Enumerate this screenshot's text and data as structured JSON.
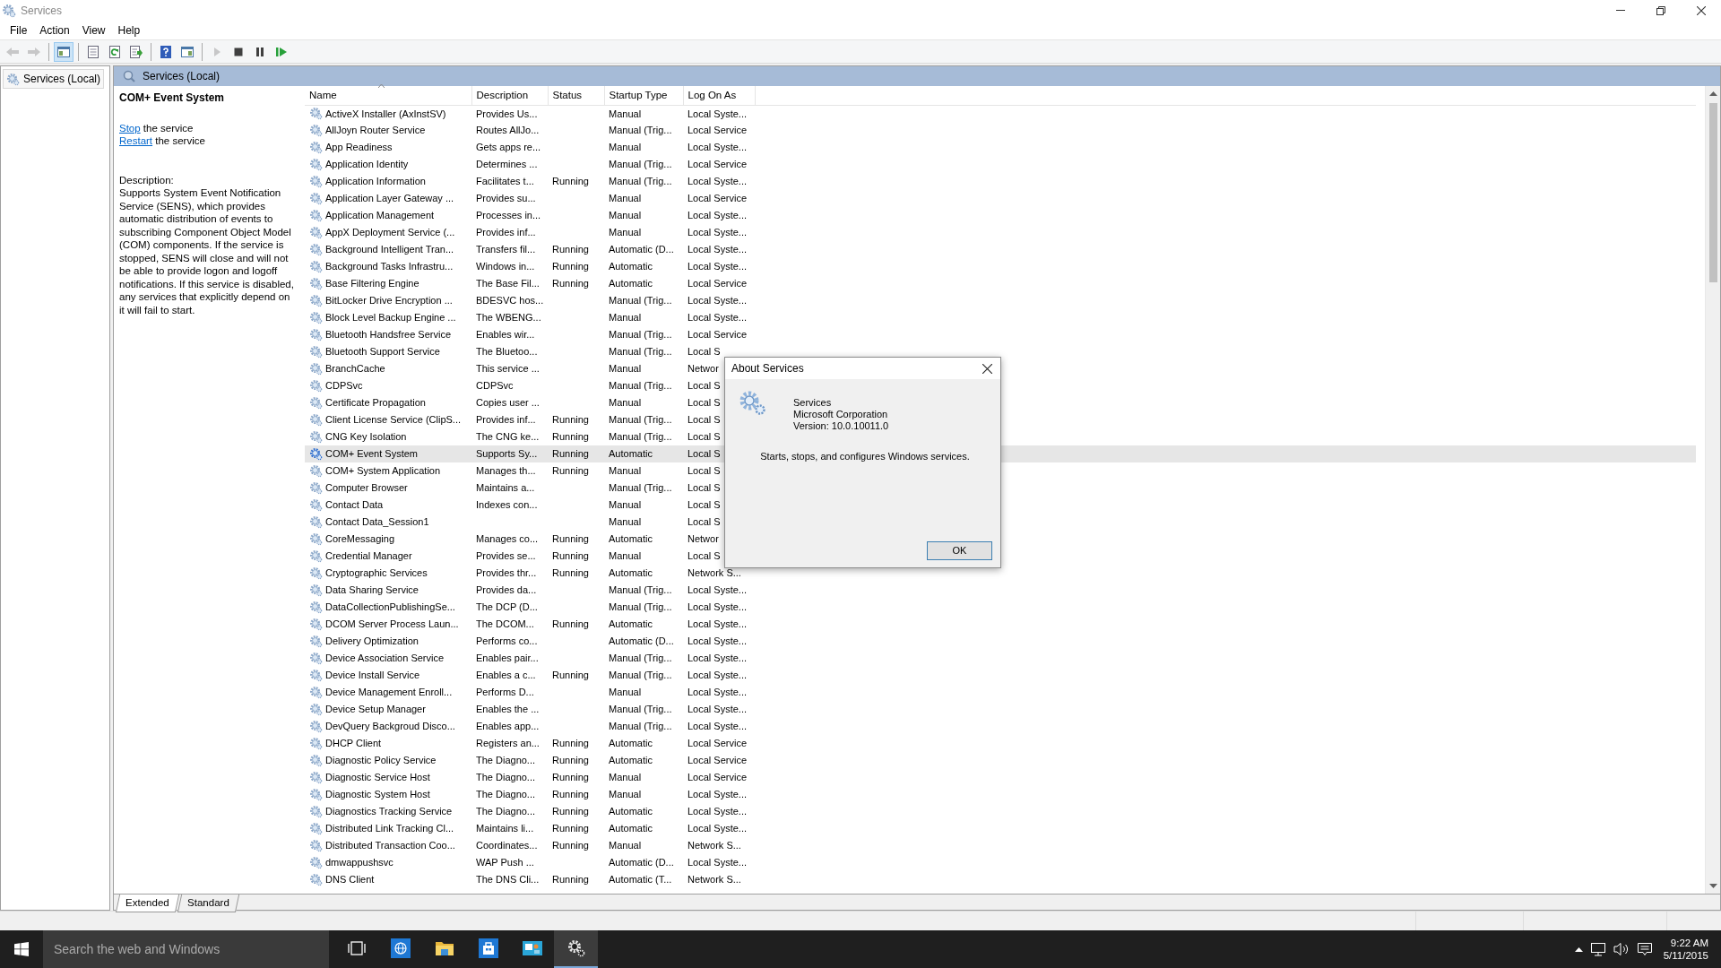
{
  "window": {
    "title": "Services"
  },
  "menu": [
    {
      "label": "File"
    },
    {
      "label": "Action"
    },
    {
      "label": "View"
    },
    {
      "label": "Help"
    }
  ],
  "toolbar": [
    {
      "kind": "back",
      "disabled": true,
      "pressed": false
    },
    {
      "kind": "forward",
      "disabled": true,
      "pressed": false
    },
    {
      "kind": "separator"
    },
    {
      "kind": "tree",
      "disabled": false,
      "pressed": true
    },
    {
      "kind": "separator"
    },
    {
      "kind": "properties",
      "disabled": false,
      "pressed": false
    },
    {
      "kind": "refresh",
      "disabled": false,
      "pressed": false
    },
    {
      "kind": "export",
      "disabled": false,
      "pressed": false
    },
    {
      "kind": "separator"
    },
    {
      "kind": "help",
      "disabled": false,
      "pressed": false
    },
    {
      "kind": "actionpane",
      "disabled": false,
      "pressed": false
    },
    {
      "kind": "separator"
    },
    {
      "kind": "start",
      "disabled": true,
      "pressed": false
    },
    {
      "kind": "stop",
      "disabled": false,
      "pressed": false
    },
    {
      "kind": "pause",
      "disabled": false,
      "pressed": false
    },
    {
      "kind": "resume",
      "disabled": false,
      "pressed": false
    }
  ],
  "tree": [
    {
      "label": "Services (Local)",
      "selected": true
    }
  ],
  "pane_header": "Services (Local)",
  "details": {
    "title": "COM+ Event System",
    "actions": [
      {
        "link": "Stop",
        "text": "the service"
      },
      {
        "link": "Restart",
        "text": "the service"
      }
    ],
    "description_label": "Description:",
    "description": "Supports System Event Notification Service (SENS), which provides automatic distribution of events to subscribing Component Object Model (COM) components. If the service is stopped, SENS will close and will not be able to provide logon and logoff notifications. If this service is disabled, any services that explicitly depend on it will fail to start."
  },
  "table": {
    "columns": [
      {
        "label": "Name",
        "sorted": true
      },
      {
        "label": "Description",
        "sorted": false
      },
      {
        "label": "Status",
        "sorted": false
      },
      {
        "label": "Startup Type",
        "sorted": false
      },
      {
        "label": "Log On As",
        "sorted": false
      }
    ],
    "rows": [
      {
        "name": "ActiveX Installer (AxInstSV)",
        "description": "Provides Us...",
        "startup": "Manual",
        "logon": "Local Syste...",
        "selected": false
      },
      {
        "name": "AllJoyn Router Service",
        "description": "Routes AllJo...",
        "startup": "Manual (Trig...",
        "logon": "Local Service",
        "selected": false
      },
      {
        "name": "App Readiness",
        "description": "Gets apps re...",
        "startup": "Manual",
        "logon": "Local Syste...",
        "selected": false
      },
      {
        "name": "Application Identity",
        "description": "Determines ...",
        "startup": "Manual (Trig...",
        "logon": "Local Service",
        "selected": false
      },
      {
        "name": "Application Information",
        "description": "Facilitates t...",
        "status": "Running",
        "startup": "Manual (Trig...",
        "logon": "Local Syste...",
        "selected": false
      },
      {
        "name": "Application Layer Gateway ...",
        "description": "Provides su...",
        "startup": "Manual",
        "logon": "Local Service",
        "selected": false
      },
      {
        "name": "Application Management",
        "description": "Processes in...",
        "startup": "Manual",
        "logon": "Local Syste...",
        "selected": false
      },
      {
        "name": "AppX Deployment Service (...",
        "description": "Provides inf...",
        "startup": "Manual",
        "logon": "Local Syste...",
        "selected": false
      },
      {
        "name": "Background Intelligent Tran...",
        "description": "Transfers fil...",
        "status": "Running",
        "startup": "Automatic (D...",
        "logon": "Local Syste...",
        "selected": false
      },
      {
        "name": "Background Tasks Infrastru...",
        "description": "Windows in...",
        "status": "Running",
        "startup": "Automatic",
        "logon": "Local Syste...",
        "selected": false
      },
      {
        "name": "Base Filtering Engine",
        "description": "The Base Fil...",
        "status": "Running",
        "startup": "Automatic",
        "logon": "Local Service",
        "selected": false
      },
      {
        "name": "BitLocker Drive Encryption ...",
        "description": "BDESVC hos...",
        "startup": "Manual (Trig...",
        "logon": "Local Syste...",
        "selected": false
      },
      {
        "name": "Block Level Backup Engine ...",
        "description": "The WBENG...",
        "startup": "Manual",
        "logon": "Local Syste...",
        "selected": false
      },
      {
        "name": "Bluetooth Handsfree Service",
        "description": "Enables wir...",
        "startup": "Manual (Trig...",
        "logon": "Local Service",
        "selected": false
      },
      {
        "name": "Bluetooth Support Service",
        "description": "The Bluetoo...",
        "startup": "Manual (Trig...",
        "logon": "Local S",
        "selected": false
      },
      {
        "name": "BranchCache",
        "description": "This service ...",
        "startup": "Manual",
        "logon": "Networ",
        "selected": false
      },
      {
        "name": "CDPSvc",
        "description": "CDPSvc",
        "startup": "Manual (Trig...",
        "logon": "Local S",
        "selected": false
      },
      {
        "name": "Certificate Propagation",
        "description": "Copies user ...",
        "startup": "Manual",
        "logon": "Local S",
        "selected": false
      },
      {
        "name": "Client License Service (ClipS...",
        "description": "Provides inf...",
        "status": "Running",
        "startup": "Manual (Trig...",
        "logon": "Local S",
        "selected": false
      },
      {
        "name": "CNG Key Isolation",
        "description": "The CNG ke...",
        "status": "Running",
        "startup": "Manual (Trig...",
        "logon": "Local S",
        "selected": false
      },
      {
        "name": "COM+ Event System",
        "description": "Supports Sy...",
        "status": "Running",
        "startup": "Automatic",
        "logon": "Local S",
        "selected": true
      },
      {
        "name": "COM+ System Application",
        "description": "Manages th...",
        "status": "Running",
        "startup": "Manual",
        "logon": "Local S",
        "selected": false
      },
      {
        "name": "Computer Browser",
        "description": "Maintains a...",
        "startup": "Manual (Trig...",
        "logon": "Local S",
        "selected": false
      },
      {
        "name": "Contact Data",
        "description": "Indexes con...",
        "startup": "Manual",
        "logon": "Local S",
        "selected": false
      },
      {
        "name": "Contact Data_Session1",
        "startup": "Manual",
        "logon": "Local S",
        "selected": false
      },
      {
        "name": "CoreMessaging",
        "description": "Manages co...",
        "status": "Running",
        "startup": "Automatic",
        "logon": "Networ",
        "selected": false
      },
      {
        "name": "Credential Manager",
        "description": "Provides se...",
        "status": "Running",
        "startup": "Manual",
        "logon": "Local S",
        "selected": false
      },
      {
        "name": "Cryptographic Services",
        "description": "Provides thr...",
        "status": "Running",
        "startup": "Automatic",
        "logon": "Network S...",
        "selected": false
      },
      {
        "name": "Data Sharing Service",
        "description": "Provides da...",
        "startup": "Manual (Trig...",
        "logon": "Local Syste...",
        "selected": false
      },
      {
        "name": "DataCollectionPublishingSe...",
        "description": "The DCP (D...",
        "startup": "Manual (Trig...",
        "logon": "Local Syste...",
        "selected": false
      },
      {
        "name": "DCOM Server Process Laun...",
        "description": "The DCOM...",
        "status": "Running",
        "startup": "Automatic",
        "logon": "Local Syste...",
        "selected": false
      },
      {
        "name": "Delivery Optimization",
        "description": "Performs co...",
        "startup": "Automatic (D...",
        "logon": "Local Syste...",
        "selected": false
      },
      {
        "name": "Device Association Service",
        "description": "Enables pair...",
        "startup": "Manual (Trig...",
        "logon": "Local Syste...",
        "selected": false
      },
      {
        "name": "Device Install Service",
        "description": "Enables a c...",
        "status": "Running",
        "startup": "Manual (Trig...",
        "logon": "Local Syste...",
        "selected": false
      },
      {
        "name": "Device Management Enroll...",
        "description": "Performs D...",
        "startup": "Manual",
        "logon": "Local Syste...",
        "selected": false
      },
      {
        "name": "Device Setup Manager",
        "description": "Enables the ...",
        "startup": "Manual (Trig...",
        "logon": "Local Syste...",
        "selected": false
      },
      {
        "name": "DevQuery Backgroud Disco...",
        "description": "Enables app...",
        "startup": "Manual (Trig...",
        "logon": "Local Syste...",
        "selected": false
      },
      {
        "name": "DHCP Client",
        "description": "Registers an...",
        "status": "Running",
        "startup": "Automatic",
        "logon": "Local Service",
        "selected": false
      },
      {
        "name": "Diagnostic Policy Service",
        "description": "The Diagno...",
        "status": "Running",
        "startup": "Automatic",
        "logon": "Local Service",
        "selected": false
      },
      {
        "name": "Diagnostic Service Host",
        "description": "The Diagno...",
        "status": "Running",
        "startup": "Manual",
        "logon": "Local Service",
        "selected": false
      },
      {
        "name": "Diagnostic System Host",
        "description": "The Diagno...",
        "status": "Running",
        "startup": "Manual",
        "logon": "Local Syste...",
        "selected": false
      },
      {
        "name": "Diagnostics Tracking Service",
        "description": "The Diagno...",
        "status": "Running",
        "startup": "Automatic",
        "logon": "Local Syste...",
        "selected": false
      },
      {
        "name": "Distributed Link Tracking Cl...",
        "description": "Maintains li...",
        "status": "Running",
        "startup": "Automatic",
        "logon": "Local Syste...",
        "selected": false
      },
      {
        "name": "Distributed Transaction Coo...",
        "description": "Coordinates...",
        "status": "Running",
        "startup": "Manual",
        "logon": "Network S...",
        "selected": false
      },
      {
        "name": "dmwappushsvc",
        "description": "WAP Push ...",
        "startup": "Automatic (D...",
        "logon": "Local Syste...",
        "selected": false
      },
      {
        "name": "DNS Client",
        "description": "The DNS Cli...",
        "status": "Running",
        "startup": "Automatic (T...",
        "logon": "Network S...",
        "selected": false
      }
    ]
  },
  "view_tabs": [
    {
      "label": "Extended",
      "selected": true
    },
    {
      "label": "Standard",
      "selected": false
    }
  ],
  "dialog": {
    "title": "About Services",
    "product": "Services",
    "company": "Microsoft Corporation",
    "version": "Version: 10.0.10011.0",
    "summary": "Starts, stops, and configures Windows services.",
    "button": "OK"
  },
  "taskbar": {
    "search": {
      "placeholder": "Search the web and Windows"
    },
    "apps": [
      {
        "kind": "taskview",
        "active": false
      },
      {
        "kind": "browser",
        "active": false
      },
      {
        "kind": "folder",
        "active": false
      },
      {
        "kind": "store",
        "active": false
      },
      {
        "kind": "mail",
        "active": false
      },
      {
        "kind": "gears",
        "active": true
      }
    ],
    "clock": {
      "time": "9:22 AM",
      "date": "5/11/2015"
    }
  }
}
